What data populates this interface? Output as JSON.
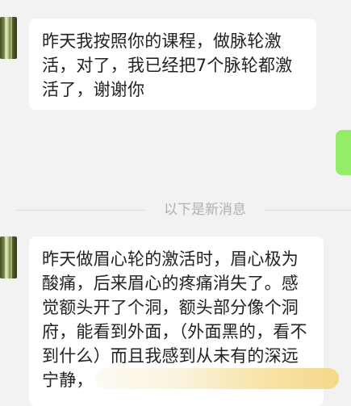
{
  "messages": [
    {
      "sender": "other",
      "text": "昨天我按照你的课程，做脉轮激活，对了，我已经把7个脉轮都激活了，谢谢你"
    },
    {
      "sender": "self",
      "text": ""
    },
    {
      "sender": "other",
      "text": "昨天做眉心轮的激活时，眉心极为酸痛，后来眉心的疼痛消失了。感觉额头开了个洞，额头部分像个洞府，能看到外面，（外面黑的，看不到什么）而且我感到从未有的深远宁静，"
    }
  ],
  "divider": {
    "label": "以下是新消息"
  }
}
